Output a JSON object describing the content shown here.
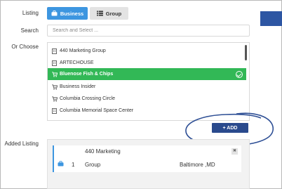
{
  "labels": {
    "listing": "Listing",
    "search": "Search",
    "or_choose": "Or Choose",
    "added_listing": "Added Listing"
  },
  "listing_type": {
    "options": [
      {
        "label": "Business",
        "icon": "briefcase-icon",
        "active": true
      },
      {
        "label": "Group",
        "icon": "list-icon",
        "active": false
      }
    ]
  },
  "search": {
    "placeholder": "Search and Select ...",
    "value": ""
  },
  "choices": [
    {
      "label": "440 Marketing Group",
      "icon": "building-icon",
      "selected": false
    },
    {
      "label": "ARTECHOUSE",
      "icon": "building-icon",
      "selected": false
    },
    {
      "label": "Bluenose Fish & Chips",
      "icon": "cart-icon",
      "selected": true
    },
    {
      "label": "Business Insider",
      "icon": "cart-icon",
      "selected": false
    },
    {
      "label": "Columbia Crossing Circle",
      "icon": "cart-icon",
      "selected": false
    },
    {
      "label": "Columbia Memorial Space Center",
      "icon": "building-icon",
      "selected": false
    }
  ],
  "add_button": {
    "label": "+ ADD"
  },
  "added": [
    {
      "index": "1",
      "name": "440 Marketing",
      "subname": "Group",
      "location": "Baltimore ,MD",
      "icon": "briefcase-icon"
    }
  ],
  "colors": {
    "accent": "#3d96e0",
    "selected_row": "#32b856",
    "add_button": "#2a4a8d",
    "halo": "#2e4f95"
  }
}
